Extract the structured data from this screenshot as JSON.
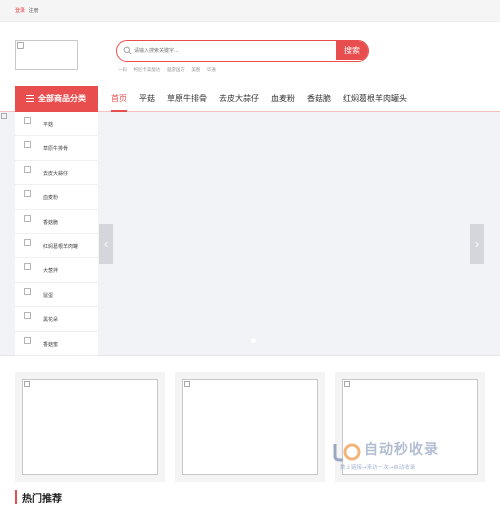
{
  "topbar": {
    "login": "登录",
    "register": "注册"
  },
  "search": {
    "placeholder": "请输入搜索关键字...",
    "button_label": "搜索"
  },
  "hot_words": [
    "一码",
    "柯尼卡美能达",
    "遨游国方",
    "美图",
    "华通"
  ],
  "nav": {
    "category_label": "全部商品分类",
    "links": [
      "首页",
      "平菇",
      "草原牛排骨",
      "去皮大蒜仔",
      "血麦粉",
      "香菇脆",
      "红焖葛根羊肉罐头"
    ]
  },
  "sidebar": {
    "items": [
      "平菇",
      "草原牛排骨",
      "去皮大蒜仔",
      "血麦粉",
      "香菇脆",
      "红焖葛根羊肉罐",
      "大葱拌",
      "鼠蛋",
      "黑花朵",
      "香菇蜜"
    ]
  },
  "banner": {
    "prev_arrow": "‹",
    "next_arrow": "›"
  },
  "watermark": {
    "title": "自动秒收录",
    "subtitle": "数上链接→来访一次→自动收录"
  },
  "section": {
    "title": "热门推荐"
  },
  "colors": {
    "accent": "#e94e4e",
    "banner_bg": "#f2f3f7"
  }
}
